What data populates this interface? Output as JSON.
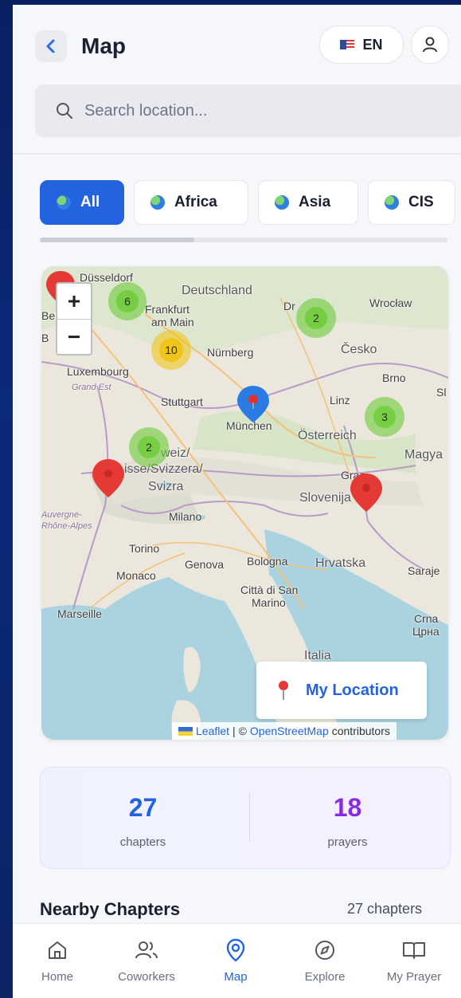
{
  "header": {
    "title": "Map",
    "back_icon": "chevron-left-icon",
    "language": "EN",
    "profile_icon": "user-icon"
  },
  "search": {
    "placeholder": "Search location..."
  },
  "filters": [
    {
      "label": "All",
      "active": true
    },
    {
      "label": "Africa",
      "active": false
    },
    {
      "label": "Asia",
      "active": false
    },
    {
      "label": "CIS",
      "active": false
    }
  ],
  "map": {
    "zoom_in": "+",
    "zoom_out": "−",
    "labels": {
      "dusseldorf": "Düsseldorf",
      "deutschland": "Deutschland",
      "frankfurt": "Frankfurt",
      "am_main": "am Main",
      "dresden": "Dr",
      "wroclaw": "Wrocław",
      "belgie": "Belgie /",
      "b": "B",
      "nurnberg": "Nürnberg",
      "cesko": "Česko",
      "luxembourg": "Luxembourg",
      "grand_est": "Grand Est",
      "brno": "Brno",
      "stuttgart": "Stuttgart",
      "linz": "Linz",
      "sl": "Sl",
      "munchen": "München",
      "osterreich": "Österreich",
      "magya": "Magya",
      "schweiz": "weiz/",
      "suisse": "isse/Svizzera/",
      "svizra": "Svizra",
      "graz": "Graz",
      "slovenija": "Slovenija",
      "auvergne": "Auvergne-",
      "rhone": "Rhône-Alpes",
      "milano": "Milano",
      "torino": "Torino",
      "genova": "Genova",
      "bologna": "Bologna",
      "hrvatska": "Hrvatska",
      "saraje": "Saraje",
      "monaco": "Monaco",
      "citta": "Città di San",
      "marino": "Marino",
      "marseille": "Marseille",
      "crna": "Crna",
      "crna2": "Црна",
      "italia": "Italia"
    },
    "clusters": [
      {
        "count": "6",
        "color": "green"
      },
      {
        "count": "10",
        "color": "yellow"
      },
      {
        "count": "2",
        "color": "green"
      },
      {
        "count": "3",
        "color": "green"
      },
      {
        "count": "2",
        "color": "green"
      }
    ],
    "my_location": "My Location",
    "attribution": {
      "leaflet": "Leaflet",
      "sep": "| ©",
      "osm": "OpenStreetMap",
      "contributors": "contributors"
    }
  },
  "stats": {
    "chapters_value": "27",
    "chapters_label": "chapters",
    "prayers_value": "18",
    "prayers_label": "prayers",
    "chapters_color": "#2463e0",
    "prayers_color": "#8a2be2"
  },
  "nearby": {
    "title": "Nearby Chapters",
    "count": "27 chapters"
  },
  "nav": [
    {
      "label": "Home",
      "icon": "home-icon"
    },
    {
      "label": "Coworkers",
      "icon": "users-icon"
    },
    {
      "label": "Map",
      "icon": "map-pin-icon",
      "active": true
    },
    {
      "label": "Explore",
      "icon": "compass-icon"
    },
    {
      "label": "My Prayer",
      "icon": "book-icon"
    }
  ]
}
